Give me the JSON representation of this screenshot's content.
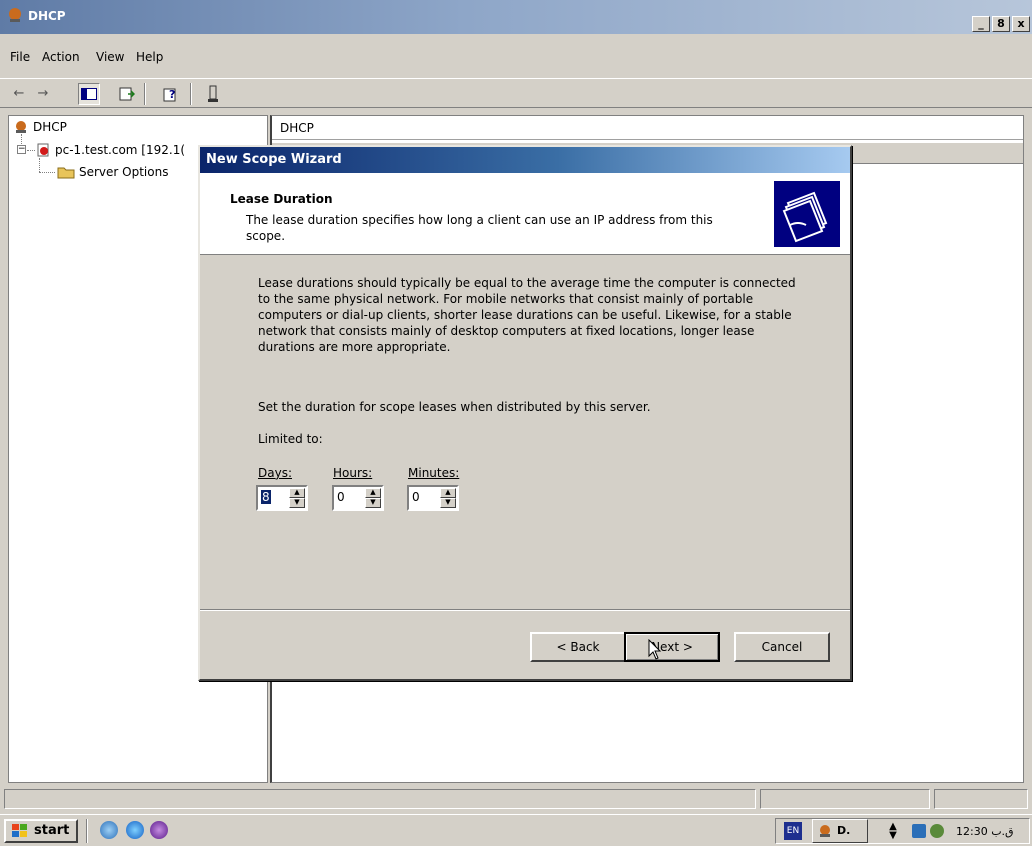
{
  "window": {
    "title": "DHCP",
    "controls": [
      "_",
      "8",
      "x"
    ]
  },
  "menu": [
    "File",
    "Action",
    "View",
    "Help"
  ],
  "tree": {
    "root": "DHCP",
    "server": "pc-1.test.com [192.1(",
    "child": "Server Options"
  },
  "right_pane": {
    "header": "DHCP"
  },
  "wizard": {
    "title": "New Scope Wizard",
    "header_title": "Lease Duration",
    "header_desc": "The lease duration specifies how long a client can use an IP address from this scope.",
    "para1": "Lease durations should typically be equal to the average time the computer is connected to the same physical network. For mobile networks that consist mainly of portable computers or dial-up clients, shorter lease durations can be useful. Likewise, for a stable network that consists mainly of desktop computers at fixed locations, longer lease durations are more appropriate.",
    "para2": "Set the duration for scope leases when distributed by this server.",
    "limited_to": "Limited to:",
    "days_label": "Days:",
    "hours_label": "Hours:",
    "minutes_label": "Minutes:",
    "days_value": "8",
    "hours_value": "0",
    "minutes_value": "0",
    "back_label": "< Back",
    "next_label": "Next >",
    "cancel_label": "Cancel"
  },
  "taskbar": {
    "start_label": "start",
    "lang": "EN",
    "task_label": "D.",
    "clock": "12:30 ق.ب"
  },
  "colors": {
    "title_blue": "#0a246a",
    "face": "#d4d0c8"
  }
}
